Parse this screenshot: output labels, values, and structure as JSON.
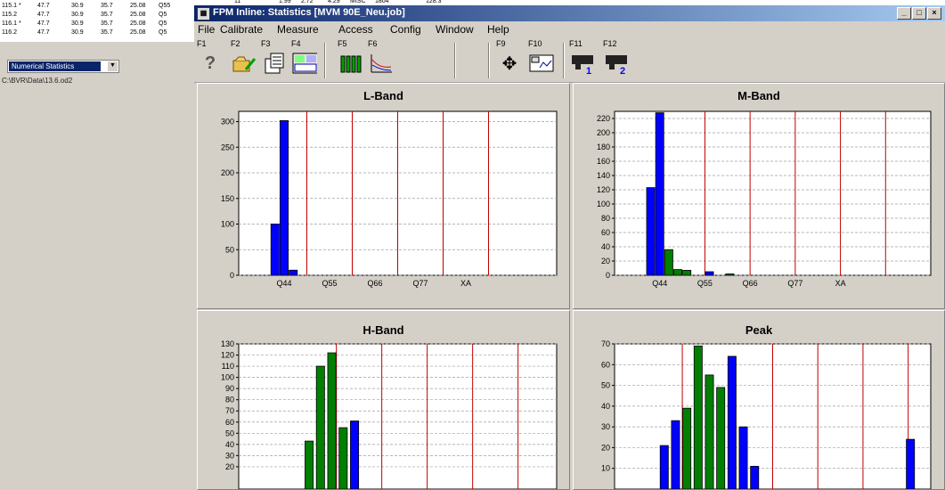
{
  "background_app": {
    "rows": [
      {
        "c1": "115.1 *",
        "c2": "47.7",
        "c3": "30.9",
        "c4": "35.7",
        "c5": "25.08",
        "c6": "Q55"
      },
      {
        "c1": "115.2",
        "c2": "47.7",
        "c3": "30.9",
        "c4": "35.7",
        "c5": "25.08",
        "c6": "Q5"
      },
      {
        "c1": "116.1 *",
        "c2": "47.7",
        "c3": "30.9",
        "c4": "35.7",
        "c5": "25.08",
        "c6": "Q5"
      },
      {
        "c1": "116.2",
        "c2": "47.7",
        "c3": "30.9",
        "c4": "35.7",
        "c5": "25.08",
        "c6": "Q5"
      }
    ],
    "top_strip": [
      "11",
      "1.99",
      "2.72",
      "4.29",
      "MISC",
      "1804",
      "128.3"
    ],
    "combo_value": "Numerical Statistics",
    "path": "C:\\BVR\\Data\\13.6.od2"
  },
  "window": {
    "title": "FPM Inline: Statistics  [MVM 90E_Neu.job]",
    "title_icon": "app-icon",
    "controls": [
      "_",
      "□",
      "×"
    ]
  },
  "menu": [
    "File",
    "Calibrate",
    "Measure",
    "Access",
    "Config",
    "Window",
    "Help"
  ],
  "toolbar": [
    {
      "key": "F1",
      "icon": "help-icon"
    },
    {
      "key": "F2",
      "icon": "open-folder-icon"
    },
    {
      "key": "F3",
      "icon": "report-icon"
    },
    {
      "key": "F4",
      "icon": "statistics-table-icon"
    },
    {
      "key": "F5",
      "icon": "bar-chart-icon"
    },
    {
      "key": "F6",
      "icon": "line-chart-icon"
    },
    {
      "key": "F9",
      "icon": "move-cursor-icon"
    },
    {
      "key": "F10",
      "icon": "trend-window-icon"
    },
    {
      "key": "F11",
      "icon": "sensor-1-icon",
      "badge": "1"
    },
    {
      "key": "F12",
      "icon": "sensor-2-icon",
      "badge": "2"
    }
  ],
  "colors": {
    "blue": "#0000ff",
    "green": "#007f00",
    "red_line": "#c00000",
    "grid": "#a0a0a0"
  },
  "chart_data": [
    {
      "type": "bar",
      "title": "L-Band",
      "ylim": [
        0,
        320
      ],
      "yticks": [
        0,
        50,
        100,
        150,
        200,
        250,
        300
      ],
      "xticklabels": [
        "Q44",
        "Q55",
        "Q66",
        "Q77",
        "XA"
      ],
      "bars": [
        {
          "pos": 0.8,
          "value": 100,
          "color": "blue"
        },
        {
          "pos": 1.0,
          "value": 302,
          "color": "blue"
        },
        {
          "pos": 1.2,
          "value": 10,
          "color": "blue"
        }
      ],
      "separators": [
        1.5,
        2.5,
        3.5,
        4.5,
        5.5
      ]
    },
    {
      "type": "bar",
      "title": "M-Band",
      "ylim": [
        0,
        230
      ],
      "yticks": [
        0,
        20,
        40,
        60,
        80,
        100,
        120,
        140,
        160,
        180,
        200,
        220
      ],
      "xticklabels": [
        "Q44",
        "Q55",
        "Q66",
        "Q77",
        "XA"
      ],
      "bars": [
        {
          "pos": 0.8,
          "value": 123,
          "color": "blue"
        },
        {
          "pos": 1.0,
          "value": 228,
          "color": "blue"
        },
        {
          "pos": 1.2,
          "value": 36,
          "color": "green"
        },
        {
          "pos": 1.4,
          "value": 8,
          "color": "green"
        },
        {
          "pos": 1.6,
          "value": 7,
          "color": "green"
        },
        {
          "pos": 2.1,
          "value": 5,
          "color": "blue"
        },
        {
          "pos": 2.55,
          "value": 2,
          "color": "green"
        }
      ],
      "separators": [
        2.0,
        3.0,
        4.0,
        5.0,
        6.0
      ]
    },
    {
      "type": "bar",
      "title": "H-Band",
      "ylim": [
        0,
        130
      ],
      "yticks": [
        20,
        30,
        40,
        50,
        60,
        70,
        80,
        90,
        100,
        110,
        120,
        130
      ],
      "xticklabels": [],
      "bars": [
        {
          "pos": 1.55,
          "value": 43,
          "color": "green"
        },
        {
          "pos": 1.8,
          "value": 110,
          "color": "green"
        },
        {
          "pos": 2.05,
          "value": 122,
          "color": "green"
        },
        {
          "pos": 2.3,
          "value": 55,
          "color": "green"
        },
        {
          "pos": 2.55,
          "value": 61,
          "color": "blue"
        }
      ],
      "separators": [
        2.15,
        3.15,
        4.15,
        5.15,
        6.15
      ]
    },
    {
      "type": "bar",
      "title": "Peak",
      "ylim": [
        0,
        70
      ],
      "yticks": [
        10,
        20,
        30,
        40,
        50,
        60,
        70
      ],
      "xticklabels": [],
      "bars": [
        {
          "pos": 1.1,
          "value": 21,
          "color": "blue"
        },
        {
          "pos": 1.35,
          "value": 33,
          "color": "blue"
        },
        {
          "pos": 1.6,
          "value": 39,
          "color": "green"
        },
        {
          "pos": 1.85,
          "value": 69,
          "color": "green"
        },
        {
          "pos": 2.1,
          "value": 55,
          "color": "green"
        },
        {
          "pos": 2.35,
          "value": 49,
          "color": "green"
        },
        {
          "pos": 2.6,
          "value": 64,
          "color": "blue"
        },
        {
          "pos": 2.85,
          "value": 30,
          "color": "blue"
        },
        {
          "pos": 3.1,
          "value": 11,
          "color": "blue"
        },
        {
          "pos": 6.55,
          "value": 24,
          "color": "blue"
        }
      ],
      "separators": [
        1.5,
        3.5,
        4.5,
        5.5,
        6.5
      ]
    }
  ]
}
